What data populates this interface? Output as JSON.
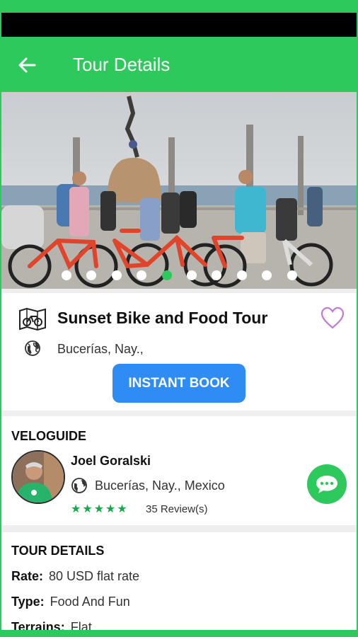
{
  "appbar": {
    "title": "Tour Details"
  },
  "carousel": {
    "slides": 10,
    "active_index": 4
  },
  "tour": {
    "title": "Sunset Bike and Food Tour",
    "location": "Bucerías, Nay.,",
    "book_label": "INSTANT BOOK"
  },
  "guide": {
    "section_title": "VELOGUIDE",
    "name": "Joel Goralski",
    "location": "Bucerías, Nay., Mexico",
    "stars": "★★★★★",
    "rating": 5,
    "reviews": "35 Review(s)"
  },
  "details": {
    "section_title": "TOUR DETAILS",
    "rows": [
      {
        "label": "Rate:",
        "value": "80 USD flat rate"
      },
      {
        "label": "Type:",
        "value": "Food And Fun"
      },
      {
        "label": "Terrains:",
        "value": "Flat"
      }
    ]
  },
  "colors": {
    "brand_green": "#2ec95c",
    "book_blue": "#2f8cf5",
    "heart": "#c07ad6"
  }
}
